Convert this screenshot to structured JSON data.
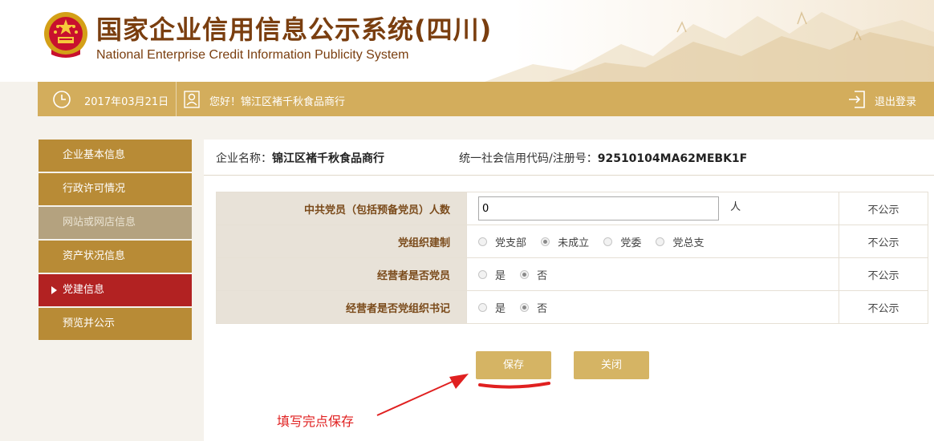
{
  "header": {
    "title": "国家企业信用信息公示系统(四川)",
    "subtitle": "National Enterprise Credit Information Publicity System"
  },
  "infobar": {
    "date": "2017年03月21日",
    "greeting": "您好！锦江区褚千秋食品商行",
    "logout": "退出登录"
  },
  "sidebar": {
    "items": [
      {
        "label": "企业基本信息"
      },
      {
        "label": "行政许可情况"
      },
      {
        "label": "网站或网店信息"
      },
      {
        "label": "资产状况信息"
      },
      {
        "label": "党建信息"
      },
      {
        "label": "预览并公示"
      }
    ]
  },
  "company": {
    "name_label": "企业名称：",
    "name": "锦江区褚千秋食品商行",
    "code_label": "统一社会信用代码/注册号：",
    "code": "92510104MA62MEBK1F"
  },
  "form": {
    "rows": [
      {
        "label": "中共党员（包括预备党员）人数",
        "value": "0",
        "unit": "人",
        "publicity": "不公示"
      },
      {
        "label": "党组织建制",
        "options": [
          "党支部",
          "未成立",
          "党委",
          "党总支"
        ],
        "selected": "未成立",
        "publicity": "不公示"
      },
      {
        "label": "经营者是否党员",
        "options": [
          "是",
          "否"
        ],
        "selected": "否",
        "publicity": "不公示"
      },
      {
        "label": "经营者是否党组织书记",
        "options": [
          "是",
          "否"
        ],
        "selected": "否",
        "publicity": "不公示"
      }
    ]
  },
  "buttons": {
    "save": "保存",
    "close": "关闭"
  },
  "annotation": {
    "text": "填写完点保存",
    "color": "#e02020"
  },
  "colors": {
    "brand_gold": "#d3ad5c",
    "sidebar_gold": "#b88b36",
    "active_red": "#b22222",
    "title_brown": "#7a3e0f"
  }
}
